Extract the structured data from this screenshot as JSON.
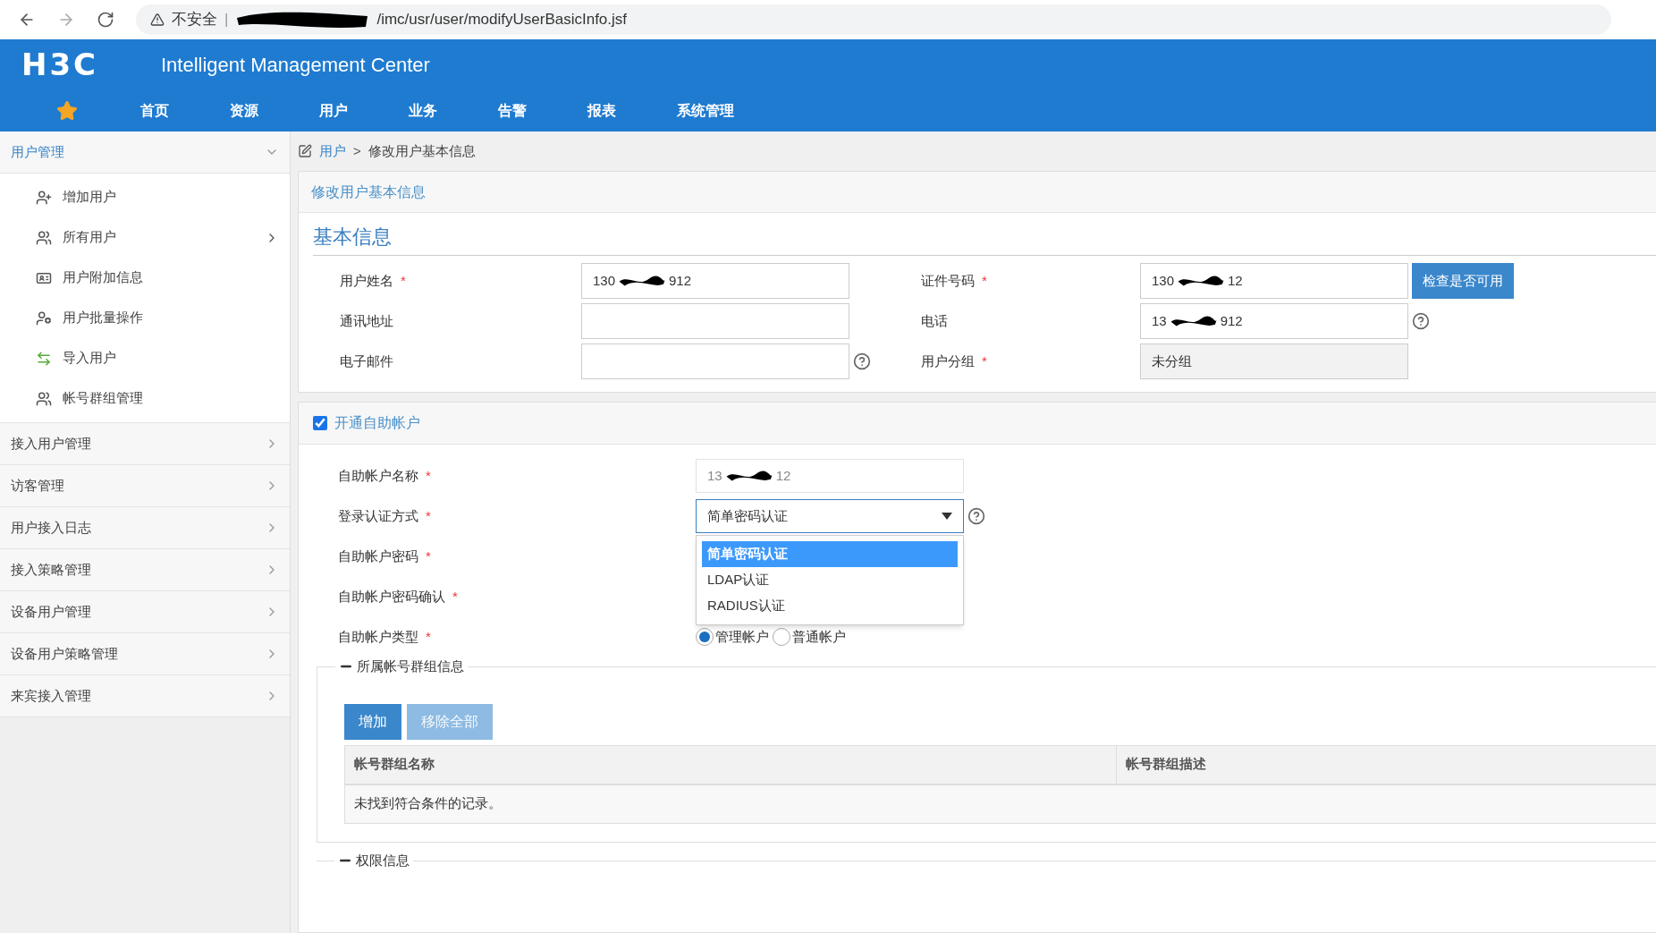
{
  "browser": {
    "warning": "不安全",
    "separator": "|",
    "url_tail": "/imc/usr/user/modifyUserBasicInfo.jsf"
  },
  "header": {
    "logo": "H3C",
    "title": "Intelligent Management Center"
  },
  "nav": [
    "首页",
    "资源",
    "用户",
    "业务",
    "告警",
    "报表",
    "系统管理"
  ],
  "sidebar": [
    {
      "label": "用户管理",
      "expanded": true,
      "children": [
        {
          "label": "增加用户",
          "kind": "add",
          "submenu": false
        },
        {
          "label": "所有用户",
          "kind": "group",
          "submenu": true
        },
        {
          "label": "用户附加信息",
          "kind": "card",
          "submenu": false
        },
        {
          "label": "用户批量操作",
          "kind": "tools",
          "submenu": false
        },
        {
          "label": "导入用户",
          "kind": "import",
          "submenu": false
        },
        {
          "label": "帐号群组管理",
          "kind": "pair",
          "submenu": false
        }
      ]
    },
    {
      "label": "接入用户管理",
      "expanded": false
    },
    {
      "label": "访客管理",
      "expanded": false
    },
    {
      "label": "用户接入日志",
      "expanded": false
    },
    {
      "label": "接入策略管理",
      "expanded": false
    },
    {
      "label": "设备用户管理",
      "expanded": false
    },
    {
      "label": "设备用户策略管理",
      "expanded": false
    },
    {
      "label": "来宾接入管理",
      "expanded": false
    }
  ],
  "breadcrumb": {
    "link": "用户",
    "separator": ">",
    "current": "修改用户基本信息"
  },
  "basic_panel": {
    "title": "修改用户基本信息",
    "heading": "基本信息",
    "check_button": "检查是否可用",
    "fields": [
      {
        "label": "用户姓名",
        "required_mark": "*",
        "value_head": "130",
        "value_tail": "912",
        "help": false,
        "disabled": false
      },
      {
        "label": "证件号码",
        "required_mark": "*",
        "value_head": "130",
        "value_tail": "12",
        "help": false,
        "disabled": false
      },
      {
        "label": "通讯地址",
        "help": false,
        "disabled": false
      },
      {
        "label": "电话",
        "value_head": "13",
        "value_tail": "912",
        "help": true,
        "disabled": false
      },
      {
        "label": "电子邮件",
        "help": true,
        "disabled": false
      },
      {
        "label": "用户分组",
        "required_mark": "*",
        "value_head": "未分组",
        "help": false,
        "disabled": true
      }
    ]
  },
  "self_service": {
    "enabled": true,
    "title": "开通自助帐户",
    "name_field": {
      "label": "自助帐户名称",
      "required_mark": "*",
      "value_head": "13",
      "value_tail": "12"
    },
    "auth_field": {
      "label": "登录认证方式",
      "required_mark": "*",
      "value": "简单密码认证",
      "expanded": true,
      "options": [
        {
          "label": "简单密码认证",
          "selected": true
        },
        {
          "label": "LDAP认证",
          "selected": false
        },
        {
          "label": "RADIUS认证",
          "selected": false
        }
      ]
    },
    "password_label": {
      "label": "自助帐户密码",
      "required_mark": "*"
    },
    "confirm_label": {
      "label": "自助帐户密码确认",
      "required_mark": "*"
    },
    "type_field": {
      "label": "自助帐户类型",
      "required_mark": "*",
      "options": [
        {
          "label": "管理帐户",
          "selected": true
        },
        {
          "label": "普通帐户",
          "selected": false
        }
      ]
    }
  },
  "group_section": {
    "legend": "所属帐号群组信息",
    "buttons": [
      {
        "label": "增加",
        "disabled": false
      },
      {
        "label": "移除全部",
        "disabled": true
      }
    ],
    "columns": [
      "帐号群组名称",
      "帐号群组描述"
    ],
    "empty_message": "未找到符合条件的记录。"
  },
  "permission_section": {
    "legend": "权限信息"
  }
}
